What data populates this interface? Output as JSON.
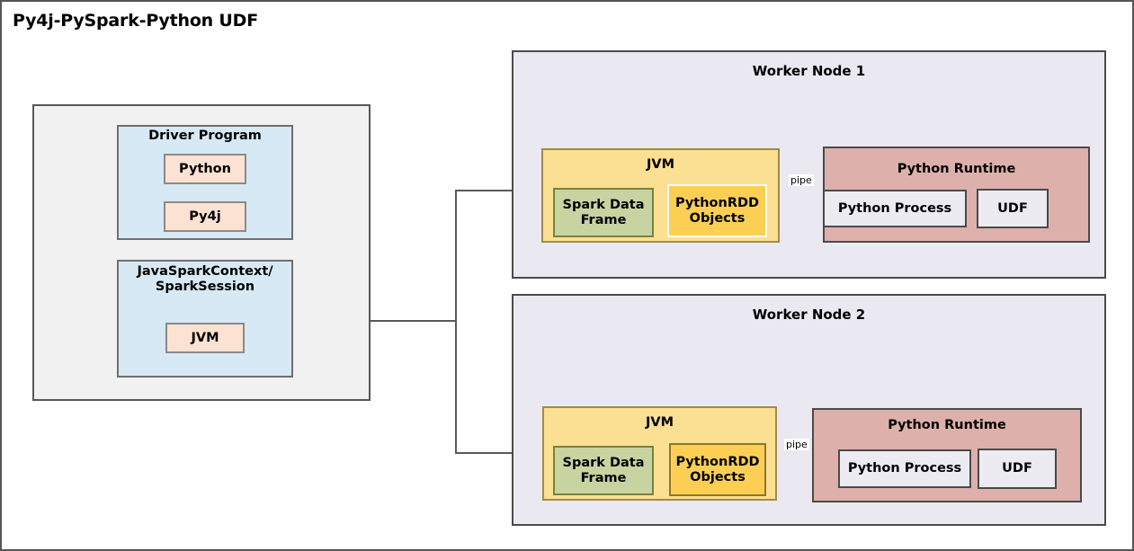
{
  "title": "Py4j-PySpark-Python UDF",
  "driver": {
    "program_label": "Driver Program",
    "python_label": "Python",
    "py4j_label": "Py4j",
    "context_label": "JavaSparkContext/\nSparkSession",
    "jvm_label": "JVM"
  },
  "workers": [
    {
      "title": "Worker Node 1",
      "jvm_label": "JVM",
      "spark_df_label": "Spark\nData Frame",
      "pythonrdd_label": "PythonRDD\nObjects",
      "pipe_label": "pipe",
      "runtime_label": "Python Runtime",
      "python_process_label": "Python Process",
      "udf_label": "UDF"
    },
    {
      "title": "Worker Node 2",
      "jvm_label": "JVM",
      "spark_df_label": "Spark\nData Frame",
      "pythonrdd_label": "PythonRDD\nObjects",
      "pipe_label": "pipe",
      "runtime_label": "Python Runtime",
      "python_process_label": "Python Process",
      "udf_label": "UDF"
    }
  ],
  "colors": {
    "driver_outer_bg": "#f1f1f1",
    "driver_blue_bg": "#d7e9f4",
    "driver_peach_bg": "#fce2d2",
    "worker_bg": "#eae8f0",
    "jvm_bg": "#fbdf92",
    "spark_df_bg": "#c7d4a2",
    "pythonrdd_bg": "#fccf54",
    "python_runtime_bg": "#ddb0ab",
    "inner_white_bg": "#edebf2",
    "line": "#595959"
  }
}
